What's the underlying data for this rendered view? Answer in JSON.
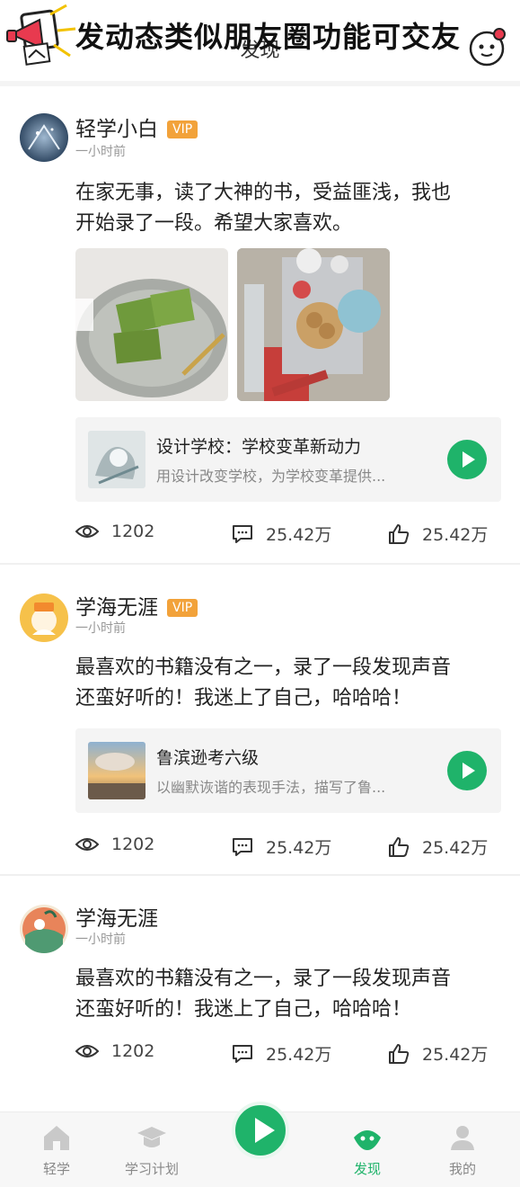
{
  "header": {
    "title": "发现",
    "banner_text": "发动态类似朋友圈功能可交友"
  },
  "posts": [
    {
      "username": "轻学小白",
      "vip": "VIP",
      "time": "一小时前",
      "content_line1": "在家无事，读了大神的书，受益匪浅，我也",
      "content_line2": "开始录了一段。希望大家喜欢。",
      "audio": {
        "title": "设计学校：学校变革新动力",
        "desc": "用设计改变学校，为学校变革提供..."
      },
      "stats": {
        "views": "1202",
        "comments": "25.42万",
        "likes": "25.42万"
      }
    },
    {
      "username": "学海无涯",
      "vip": "VIP",
      "time": "一小时前",
      "content_line1": "最喜欢的书籍没有之一，录了一段发现声音",
      "content_line2": "还蛮好听的！我迷上了自己，哈哈哈！",
      "audio": {
        "title": "鲁滨逊考六级",
        "desc": "以幽默诙谐的表现手法，描写了鲁..."
      },
      "stats": {
        "views": "1202",
        "comments": "25.42万",
        "likes": "25.42万"
      }
    },
    {
      "username": "学海无涯",
      "time": "一小时前",
      "content_line1": "最喜欢的书籍没有之一，录了一段发现声音",
      "content_line2": "还蛮好听的！我迷上了自己，哈哈哈！",
      "stats": {
        "views": "1202",
        "comments": "25.42万",
        "likes": "25.42万"
      }
    }
  ],
  "nav": {
    "items": [
      {
        "label": "轻学",
        "icon": "house-icon"
      },
      {
        "label": "学习计划",
        "icon": "graduation-cap-icon"
      },
      {
        "label": "发现",
        "icon": "discover-icon",
        "active": true
      },
      {
        "label": "我的",
        "icon": "user-icon"
      }
    ]
  },
  "colors": {
    "accent": "#1fb36a",
    "vip": "#f2a23a",
    "text": "#222222",
    "muted": "#999999"
  }
}
